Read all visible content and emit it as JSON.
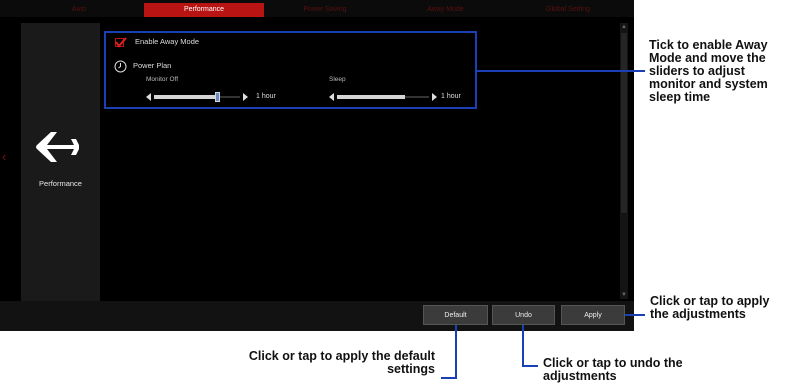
{
  "tabs": [
    {
      "label": "Auto"
    },
    {
      "label": "Performance"
    },
    {
      "label": "Power Saving"
    },
    {
      "label": "Away Mode"
    },
    {
      "label": "Global Setting"
    }
  ],
  "sidebar": {
    "label": "Performance",
    "icon": "airplane-icon"
  },
  "away_mode": {
    "checkbox_label": "Enable Away Mode",
    "checked": true,
    "power_plan_label": "Power Plan",
    "monitor_off_label": "Monitor Off",
    "sleep_label": "Sleep",
    "monitor_off_value": "1 hour",
    "sleep_value": "1 hour"
  },
  "buttons": {
    "default": "Default",
    "undo": "Undo",
    "apply": "Apply"
  },
  "annotations": {
    "tick": "Tick to enable Away Mode and move the sliders to adjust monitor and system sleep time",
    "apply": "Click or tap to apply the adjustments",
    "default": "Click or tap to apply the default settings",
    "undo": "Click or tap to undo the adjustments"
  },
  "colors": {
    "accent": "#b81414",
    "highlight": "#1b3fb5"
  }
}
